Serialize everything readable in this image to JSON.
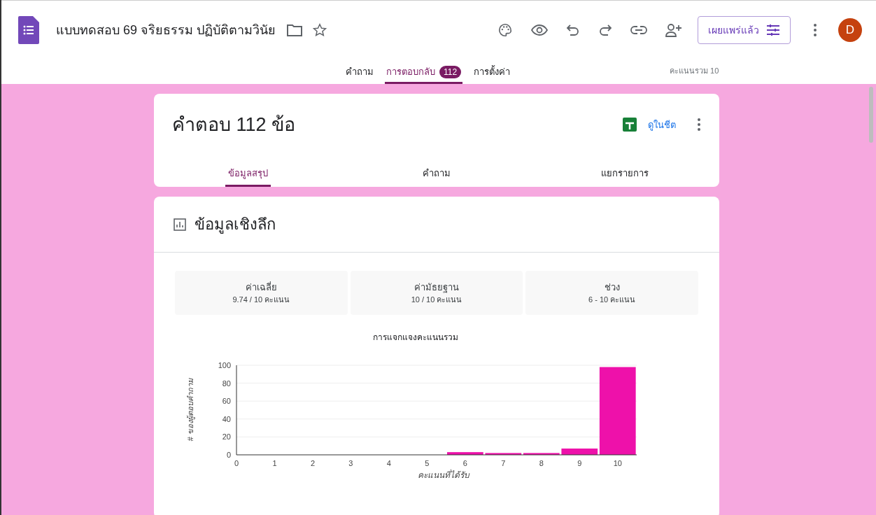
{
  "header": {
    "title": "แบบทดสอบ 69 จริยธรรม ปฏิบัติตามวินัย",
    "publish_button": "เผยแพร่แล้ว",
    "avatar": "D"
  },
  "tabs": [
    {
      "label": "คำถาม",
      "selected": false
    },
    {
      "label": "การตอบกลับ",
      "selected": true,
      "badge": "112"
    },
    {
      "label": "การตั้งค่า",
      "selected": false
    }
  ],
  "total_points": "คะแนนรวม 10",
  "responses_card": {
    "title": "คำตอบ 112 ข้อ",
    "sheets_link": "ดูในชีต",
    "tabs": [
      {
        "label": "ข้อมูลสรุป",
        "selected": true
      },
      {
        "label": "คำถาม",
        "selected": false
      },
      {
        "label": "แยกรายการ",
        "selected": false
      }
    ]
  },
  "insights": {
    "title": "ข้อมูลเชิงลึก",
    "stats": [
      {
        "label": "ค่าเฉลี่ย",
        "value": "9.74 / 10 คะแนน"
      },
      {
        "label": "ค่ามัธยฐาน",
        "value": "10 / 10 คะแนน"
      },
      {
        "label": "ช่วง",
        "value": "6 - 10 คะแนน"
      }
    ],
    "chart_data": {
      "type": "bar",
      "title": "การแจกแจงคะแนนรวม",
      "xlabel": "คะแนนที่ได้รับ",
      "ylabel": "# ของผู้ตอบคำถาม",
      "x": [
        6,
        7,
        8,
        9,
        10
      ],
      "series": [
        {
          "color": "#ee11aa",
          "values": [
            3,
            2,
            2,
            7,
            98
          ]
        }
      ],
      "grid": true,
      "xlim": [
        0,
        10.5
      ],
      "ylim": [
        0,
        100
      ],
      "xticks": [
        0,
        1,
        2,
        3,
        4,
        5,
        6,
        7,
        8,
        9,
        10
      ],
      "yticks": [
        0,
        20,
        40,
        60,
        80,
        100
      ]
    }
  }
}
